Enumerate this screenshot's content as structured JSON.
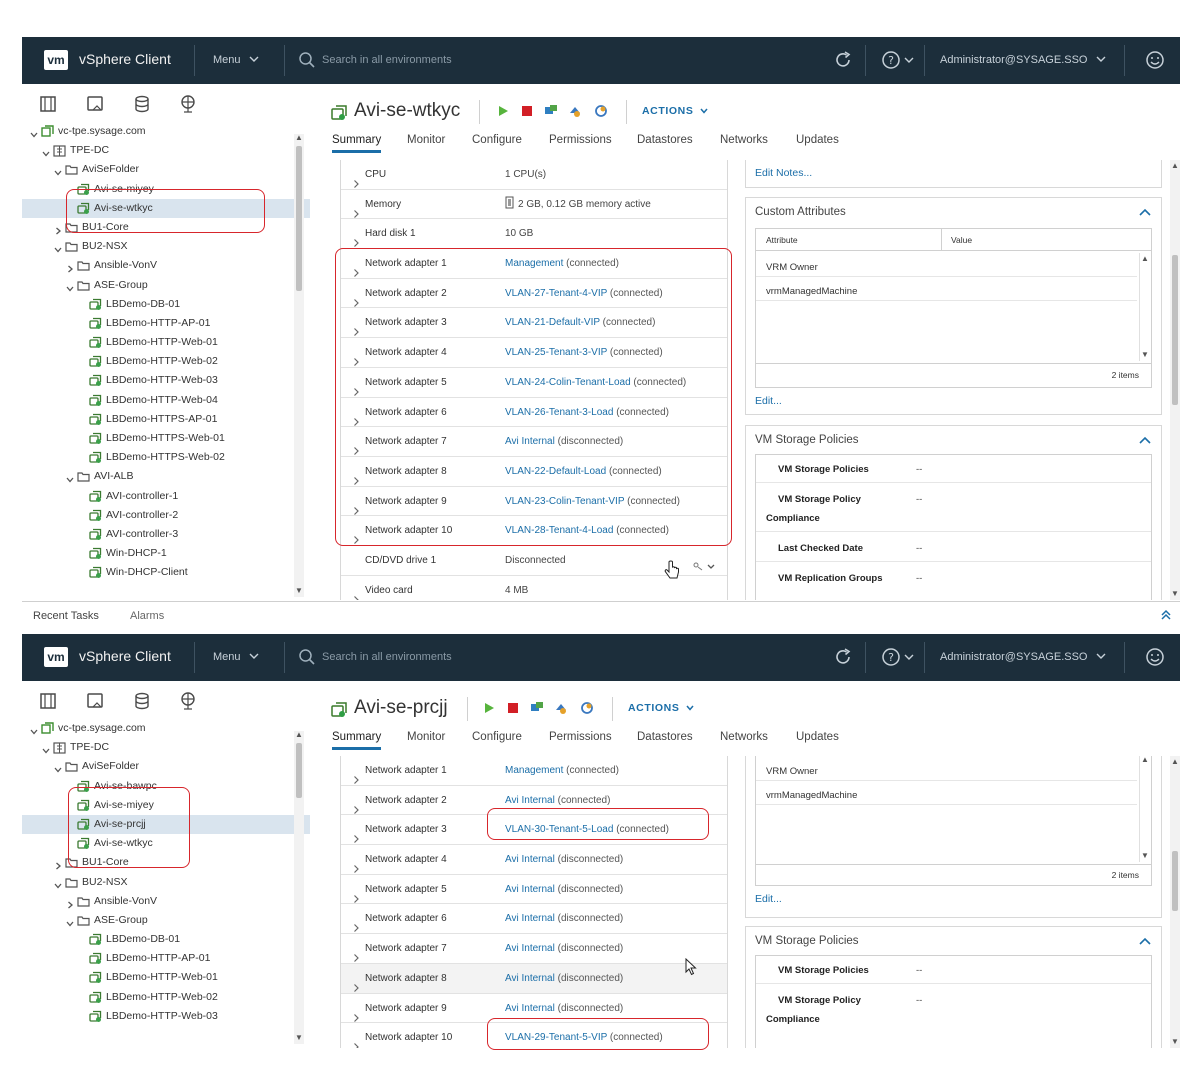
{
  "header": {
    "logo": "vm",
    "app_title": "vSphere Client",
    "menu_label": "Menu",
    "search_placeholder": "Search in all environments",
    "user": "Administrator@SYSAGE.SSO"
  },
  "bottom_bar": {
    "recent_tasks": "Recent Tasks",
    "alarms": "Alarms"
  },
  "tabs": [
    "Summary",
    "Monitor",
    "Configure",
    "Permissions",
    "Datastores",
    "Networks",
    "Updates"
  ],
  "actions_label": "ACTIONS",
  "colors": {
    "header_bg": "#1c2e3b",
    "accent": "#1b6ea8",
    "callout": "#d7262c",
    "selected_row": "#d9e4ee"
  },
  "screen1": {
    "object_title": "Avi-se-wtkyc",
    "tree": [
      {
        "label": "vc-tpe.sysage.com",
        "level": 0,
        "expanded": true,
        "icon": "vcenter-icon"
      },
      {
        "label": "TPE-DC",
        "level": 1,
        "expanded": true,
        "icon": "datacenter-icon"
      },
      {
        "label": "AviSeFolder",
        "level": 2,
        "expanded": true,
        "icon": "folder-icon"
      },
      {
        "label": "Avi-se-miyey",
        "level": 3,
        "icon": "vm-icon"
      },
      {
        "label": "Avi-se-wtkyc",
        "level": 3,
        "icon": "vm-icon",
        "selected": true
      },
      {
        "label": "BU1-Core",
        "level": 2,
        "expanded": false,
        "icon": "folder-icon"
      },
      {
        "label": "BU2-NSX",
        "level": 2,
        "expanded": true,
        "icon": "folder-icon"
      },
      {
        "label": "Ansible-VonV",
        "level": 3,
        "expanded": false,
        "icon": "folder-icon"
      },
      {
        "label": "ASE-Group",
        "level": 3,
        "expanded": true,
        "icon": "folder-icon"
      },
      {
        "label": "LBDemo-DB-01",
        "level": 4,
        "icon": "vm-icon"
      },
      {
        "label": "LBDemo-HTTP-AP-01",
        "level": 4,
        "icon": "vm-icon"
      },
      {
        "label": "LBDemo-HTTP-Web-01",
        "level": 4,
        "icon": "vm-icon"
      },
      {
        "label": "LBDemo-HTTP-Web-02",
        "level": 4,
        "icon": "vm-icon"
      },
      {
        "label": "LBDemo-HTTP-Web-03",
        "level": 4,
        "icon": "vm-icon"
      },
      {
        "label": "LBDemo-HTTP-Web-04",
        "level": 4,
        "icon": "vm-icon"
      },
      {
        "label": "LBDemo-HTTPS-AP-01",
        "level": 4,
        "icon": "vm-icon"
      },
      {
        "label": "LBDemo-HTTPS-Web-01",
        "level": 4,
        "icon": "vm-icon"
      },
      {
        "label": "LBDemo-HTTPS-Web-02",
        "level": 4,
        "icon": "vm-icon"
      },
      {
        "label": "AVI-ALB",
        "level": 3,
        "expanded": true,
        "icon": "folder-icon"
      },
      {
        "label": "AVI-controller-1",
        "level": 4,
        "icon": "vm-icon"
      },
      {
        "label": "AVI-controller-2",
        "level": 4,
        "icon": "vm-icon"
      },
      {
        "label": "AVI-controller-3",
        "level": 4,
        "icon": "vm-icon"
      },
      {
        "label": "Win-DHCP-1",
        "level": 4,
        "icon": "vm-icon"
      },
      {
        "label": "Win-DHCP-Client",
        "level": 4,
        "icon": "vm-icon"
      }
    ],
    "hardware": [
      {
        "label": "CPU",
        "value": "1 CPU(s)",
        "expand": true
      },
      {
        "label": "Memory",
        "value": "2 GB, 0.12 GB memory active",
        "expand": true,
        "mem_icon": true
      },
      {
        "label": "Hard disk 1",
        "value": "10 GB",
        "expand": true
      },
      {
        "label": "Network adapter 1",
        "link": "Management",
        "status": "(connected)",
        "expand": true
      },
      {
        "label": "Network adapter 2",
        "link": "VLAN-27-Tenant-4-VIP",
        "status": "(connected)",
        "expand": true
      },
      {
        "label": "Network adapter 3",
        "link": "VLAN-21-Default-VIP",
        "status": "(connected)",
        "expand": true
      },
      {
        "label": "Network adapter 4",
        "link": "VLAN-25-Tenant-3-VIP",
        "status": "(connected)",
        "expand": true
      },
      {
        "label": "Network adapter 5",
        "link": "VLAN-24-Colin-Tenant-Load",
        "status": "(connected)",
        "expand": true
      },
      {
        "label": "Network adapter 6",
        "link": "VLAN-26-Tenant-3-Load",
        "status": "(connected)",
        "expand": true
      },
      {
        "label": "Network adapter 7",
        "link": "Avi Internal",
        "status": "(disconnected)",
        "expand": true
      },
      {
        "label": "Network adapter 8",
        "link": "VLAN-22-Default-Load",
        "status": "(connected)",
        "expand": true
      },
      {
        "label": "Network adapter 9",
        "link": "VLAN-23-Colin-Tenant-VIP",
        "status": "(connected)",
        "expand": true
      },
      {
        "label": "Network adapter 10",
        "link": "VLAN-28-Tenant-4-Load",
        "status": "(connected)",
        "expand": true
      },
      {
        "label": "CD/DVD drive 1",
        "value": "Disconnected",
        "expand": false,
        "cd_icon": true
      },
      {
        "label": "Video card",
        "value": "4 MB",
        "expand": true
      }
    ],
    "notes_link": "Edit Notes...",
    "custom_attributes": {
      "title": "Custom Attributes",
      "col_attribute": "Attribute",
      "col_value": "Value",
      "rows": [
        "VRM Owner",
        "vrmManagedMachine"
      ],
      "count": "2 items",
      "edit_link": "Edit..."
    },
    "storage_policies": {
      "title": "VM Storage Policies",
      "rows": [
        {
          "label": "VM Storage Policies",
          "value": "--"
        },
        {
          "label": "VM Storage Policy",
          "label2": "Compliance",
          "value": "--"
        },
        {
          "label": "Last Checked Date",
          "value": "--"
        },
        {
          "label": "VM Replication Groups",
          "value": "--"
        }
      ]
    }
  },
  "screen2": {
    "object_title": "Avi-se-prcjj",
    "tree": [
      {
        "label": "vc-tpe.sysage.com",
        "level": 0,
        "expanded": true,
        "icon": "vcenter-icon"
      },
      {
        "label": "TPE-DC",
        "level": 1,
        "expanded": true,
        "icon": "datacenter-icon"
      },
      {
        "label": "AviSeFolder",
        "level": 2,
        "expanded": true,
        "icon": "folder-icon"
      },
      {
        "label": "Avi-se-bawpc",
        "level": 3,
        "icon": "vm-icon"
      },
      {
        "label": "Avi-se-miyey",
        "level": 3,
        "icon": "vm-icon"
      },
      {
        "label": "Avi-se-prcjj",
        "level": 3,
        "icon": "vm-icon",
        "selected": true
      },
      {
        "label": "Avi-se-wtkyc",
        "level": 3,
        "icon": "vm-icon"
      },
      {
        "label": "BU1-Core",
        "level": 2,
        "expanded": false,
        "icon": "folder-icon"
      },
      {
        "label": "BU2-NSX",
        "level": 2,
        "expanded": true,
        "icon": "folder-icon"
      },
      {
        "label": "Ansible-VonV",
        "level": 3,
        "expanded": false,
        "icon": "folder-icon"
      },
      {
        "label": "ASE-Group",
        "level": 3,
        "expanded": true,
        "icon": "folder-icon"
      },
      {
        "label": "LBDemo-DB-01",
        "level": 4,
        "icon": "vm-icon"
      },
      {
        "label": "LBDemo-HTTP-AP-01",
        "level": 4,
        "icon": "vm-icon"
      },
      {
        "label": "LBDemo-HTTP-Web-01",
        "level": 4,
        "icon": "vm-icon"
      },
      {
        "label": "LBDemo-HTTP-Web-02",
        "level": 4,
        "icon": "vm-icon"
      },
      {
        "label": "LBDemo-HTTP-Web-03",
        "level": 4,
        "icon": "vm-icon"
      }
    ],
    "hardware": [
      {
        "label": "Network adapter 1",
        "link": "Management",
        "status": "(connected)",
        "expand": true
      },
      {
        "label": "Network adapter 2",
        "link": "Avi Internal",
        "status": "(connected)",
        "expand": true
      },
      {
        "label": "Network adapter 3",
        "link": "VLAN-30-Tenant-5-Load",
        "status": "(connected)",
        "expand": true
      },
      {
        "label": "Network adapter 4",
        "link": "Avi Internal",
        "status": "(disconnected)",
        "expand": true
      },
      {
        "label": "Network adapter 5",
        "link": "Avi Internal",
        "status": "(disconnected)",
        "expand": true
      },
      {
        "label": "Network adapter 6",
        "link": "Avi Internal",
        "status": "(disconnected)",
        "expand": true
      },
      {
        "label": "Network adapter 7",
        "link": "Avi Internal",
        "status": "(disconnected)",
        "expand": true
      },
      {
        "label": "Network adapter 8",
        "link": "Avi Internal",
        "status": "(disconnected)",
        "expand": true,
        "hover": true
      },
      {
        "label": "Network adapter 9",
        "link": "Avi Internal",
        "status": "(disconnected)",
        "expand": true
      },
      {
        "label": "Network adapter 10",
        "link": "VLAN-29-Tenant-5-VIP",
        "status": "(connected)",
        "expand": true
      }
    ],
    "custom_attributes": {
      "rows": [
        "VRM Owner",
        "vrmManagedMachine"
      ],
      "count": "2 items",
      "edit_link": "Edit..."
    },
    "storage_policies": {
      "title": "VM Storage Policies",
      "rows": [
        {
          "label": "VM Storage Policies",
          "value": "--"
        },
        {
          "label": "VM Storage Policy",
          "label2": "Compliance",
          "value": "--"
        }
      ]
    }
  }
}
